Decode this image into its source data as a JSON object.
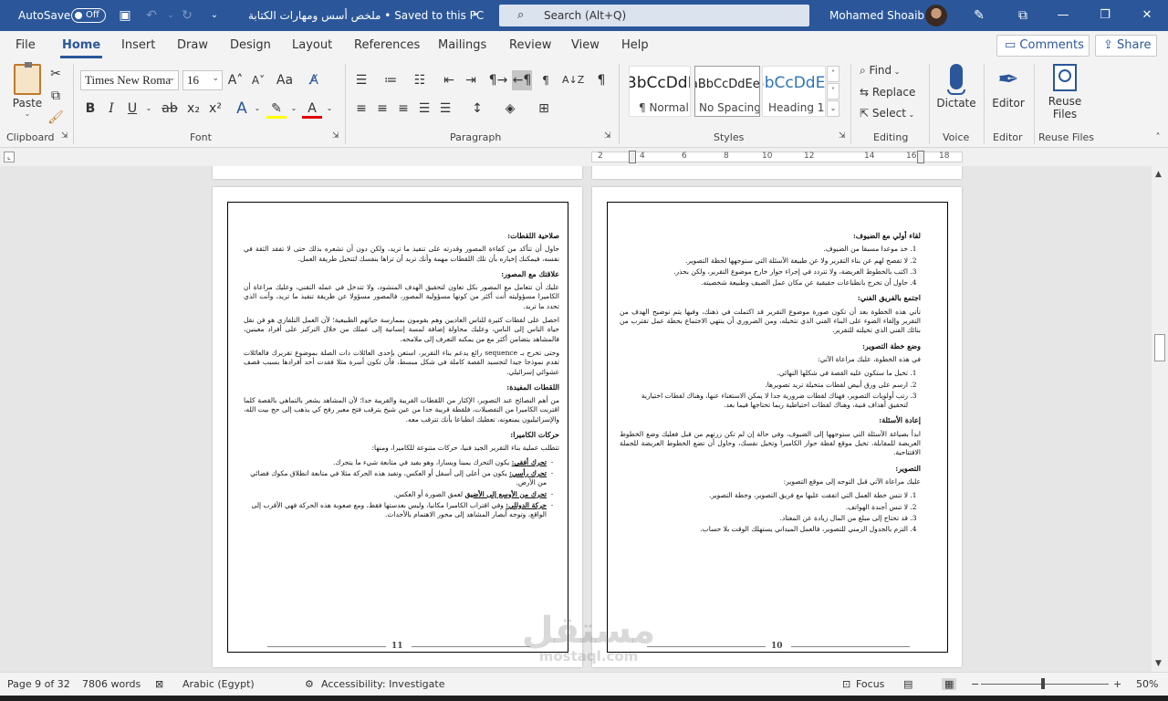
{
  "titlebar": {
    "autosave_label": "AutoSave",
    "autosave_state": "Off",
    "doc_title": "ملخص أسس ومهارات الكتابة • Saved to this PC",
    "doc_dropdown": "⌄",
    "search_placeholder": "Search (Alt+Q)",
    "user_name": "Mohamed Shoaib"
  },
  "tabs": [
    "File",
    "Home",
    "Insert",
    "Draw",
    "Design",
    "Layout",
    "References",
    "Mailings",
    "Review",
    "View",
    "Help"
  ],
  "top_actions": {
    "comments": "Comments",
    "share": "Share"
  },
  "ribbon": {
    "clipboard": {
      "paste": "Paste",
      "group": "Clipboard"
    },
    "font": {
      "family": "Times New Roma",
      "size": "16",
      "group": "Font"
    },
    "paragraph": {
      "group": "Paragraph"
    },
    "styles": {
      "group": "Styles",
      "items": [
        {
          "sample": "AaBbCcDdEe",
          "name": "¶ Normal"
        },
        {
          "sample": "AaBbCcDdEe",
          "name": "No Spacing"
        },
        {
          "sample": "AaBbCcDdEe",
          "name": "Heading 1"
        }
      ]
    },
    "editing": {
      "group": "Editing",
      "find": "Find",
      "replace": "Replace",
      "select": "Select"
    },
    "voice": {
      "dictate": "Dictate",
      "group": "Voice"
    },
    "editor": {
      "label": "Editor",
      "group": "Editor"
    },
    "reuse": {
      "label1": "Reuse",
      "label2": "Files",
      "group": "Reuse Files"
    }
  },
  "ruler": {
    "ticks": [
      "2",
      "4",
      "6",
      "8",
      "10",
      "12",
      "14",
      "16",
      "18"
    ]
  },
  "right_page": {
    "number": "10",
    "h1": "لقاء أولي مع الضيوف:",
    "list1": [
      "خذ موعدا مسبقا من الضيوف.",
      "لا تفصح لهم عن بناء التقرير ولا عن طبيعة الأسئلة التي ستوجهها لحظة التصوير.",
      "اكتب بالخطوط العريضة، ولا تتردد في إجراء حوار خارج موضوع التقرير، ولكن بحذر.",
      "حاول أن تخرج بانطباعات حقيقية عن مكان عمل الضيف وطبيعة شخصيته."
    ],
    "h2": "اجتمع بالفريق الفني:",
    "p2": "تأتي هذه الخطوة بعد أن تكون صورة موضوع التقرير قد اكتملت في ذهنك، وفيها يتم توضيح الهدف من التقرير وإلقاء الضوء على البناء الفني الذي تتخيله، ومن الضروري أن ينتهي الاجتماع بخطة عمل تقترب من بنائك الفني الذي تخيلته للتقرير.",
    "h3": "وضع خطة التصوير:",
    "p3": "في هذه الخطوة، عليك مراعاة الآتي:",
    "list3": [
      "تخيل ما ستكون عليه القصة في شكلها النهائي.",
      "ارسم على ورق أبيض لقطات متخيلة تريد تصويرها.",
      "رتب أولويات التصوير، فهناك لقطات ضرورية جدا لا يمكن الاستغناء عنها، وهناك لقطات اختيارية لتحقيق أهداف فنية، وهناك لقطات احتياطية ربما تحتاجها فيما بعد."
    ],
    "h4": "إعادة الأسئلة:",
    "p4": "ابدأ بصياغة الأسئلة التي ستوجهها إلى الضيوف، وفي حالة إن لم تكن زرتهم من قبل فعليك وضع الخطوط العريضة للمقابلة، تخيل موقع لقطة حوار الكاميرا وتخيل نفسك، وحاول أن تضع الخطوط العريضة للجملة الافتتاحية.",
    "h5": "التصوير:",
    "p5": "عليك مراعاة الآتي قبل التوجه إلى موقع التصوير:",
    "list5": [
      "لا تنس خطة العمل التي اتفقت عليها مع فريق التصوير، وخطة التصوير.",
      "لا تنس أجندة الهواتف.",
      "قد تحتاج إلى مبلغ من المال زيادة عن المعتاد.",
      "التزم بالجدول الزمني للتصوير، فالعمل الميداني يستهلك الوقت بلا حساب."
    ]
  },
  "left_page": {
    "number": "11",
    "h1": "صلاحية اللقطات:",
    "p1": "حاول أن تتأكد من كفاءة المصور وقدرته على تنفيذ ما تريد، ولكن دون أن تشعره بذلك حتى لا تفقد الثقة في نفسه، فيمكنك إخباره بأن تلك اللقطات مهمة وأنك تريد أن تراها بنفسك لتتخيل طريقة العمل.",
    "h2": "علاقتك مع المصور:",
    "p2a": "عليك أن تتعامل مع المصور بكل تعاون لتحقيق الهدف المنشود، ولا تتدخل في عمله التقني، وعليك مراعاة أن الكاميرا مسؤوليته أنت أكثر من كونها مسؤولية المصور، فالمصور مسؤولا عن طريقة تنفيذ ما تريد، وأنت الذي تحدد ما تريد.",
    "p2b": "احصل على لقطات كثيرة للناس العاديين وهم يقومون بممارسة حياتهم الطبيعية؛ لأن العمل التلفازي هو فن نقل حياة الناس إلى الناس، وعليك محاولة إضافة لمسة إنسانية إلى عملك من خلال التركيز على أفراد معينين، فالمشاهد يتضامن أكثر مع من يمكنه التعرف إلى ملامحه.",
    "p2c": "وحتى تخرج بـ sequence رائع يدعم بناء التقرير، استعن بإحدى العائلات ذات الصلة بموضوع تقريرك فالعائلات تقدم نموذجا جيدا لتجسيد القصة كاملة في شكل مبسط، فأن تكون أسرة مثلا فقدت أحد أفرادها بسبب قصف عشوائي إسرائيلي.",
    "h3": "اللقطات المفيدة:",
    "p3": "من أهم النصائح عند التصوير، الإكثار من اللقطات القريبة والقريبة جدا؛ لأن المشاهد يشعر بالتماهي بالقصة كلما اقتربت الكاميرا من التفصيلات، فلقطة قريبة جدا من عين شيخ يترقب فتح معبر رفح كي يذهب إلى حج بيت الله، والإسرائيليون يمنعونه، تعطيك انطباعا بأنك تترقب معه.",
    "h4": "حركات الكاميرا:",
    "p4": "تتطلب عملية بناء التقرير الجيد فنيا، حركات متنوعة للكاميرا، ومنها:",
    "moves": [
      {
        "t": "تحرك أفقي:",
        "d": " يكون التحرك يمينا ويسارا، وهو يفيد في متابعة شيء ما يتحرك."
      },
      {
        "t": "تحرك رأسي:",
        "d": " يكون من أعلى إلى أسفل أو العكس، وتفيد هذه الحركة مثلا في متابعة انطلاق مكوك فضائي من الأرض."
      },
      {
        "t": "تحرك من الأوسع إلى الأضيق",
        "d": " لعمق الصورة أو العكس."
      },
      {
        "t": "حركة الدوللي:",
        "d": " وفي اقتراب الكاميرا مكانيا، وليس بعدستها فقط، ومع صعوبة هذه الحركة فهي الأقرب إلى الواقع، وتوجه أبصار المشاهد إلى محور الاهتمام بالأحداث."
      }
    ]
  },
  "status": {
    "page": "Page 9 of 32",
    "words": "7806 words",
    "language": "Arabic (Egypt)",
    "accessibility": "Accessibility: Investigate",
    "focus": "Focus",
    "zoom": "50%"
  },
  "watermark": {
    "big": "مستقل",
    "small": "mostaql.com"
  }
}
